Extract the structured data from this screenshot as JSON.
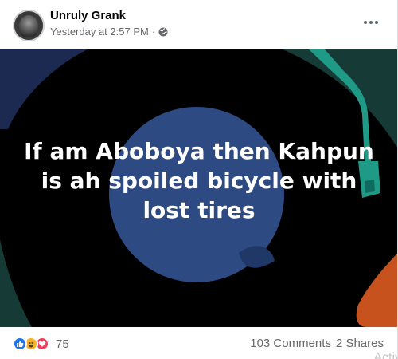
{
  "post": {
    "author": "Unruly Grank",
    "time": "Yesterday at 2:57 PM",
    "separator": "·",
    "audience_icon": "globe-icon",
    "menu_icon": "more-options-icon",
    "image_text": "If am Aboboya then Kahpun is ah spoiled bicycle with lost tires",
    "image_colors": {
      "background": "#000000",
      "disc": "#2e4a82",
      "outer_arc": "#163a35",
      "arm": "#1f9a86",
      "orange": "#c8521e"
    }
  },
  "footer": {
    "reactions": [
      "like-icon",
      "haha-icon",
      "love-icon"
    ],
    "reaction_count": "75",
    "comments": "103 Comments",
    "shares": "2 Shares",
    "watermark": "Activ"
  }
}
